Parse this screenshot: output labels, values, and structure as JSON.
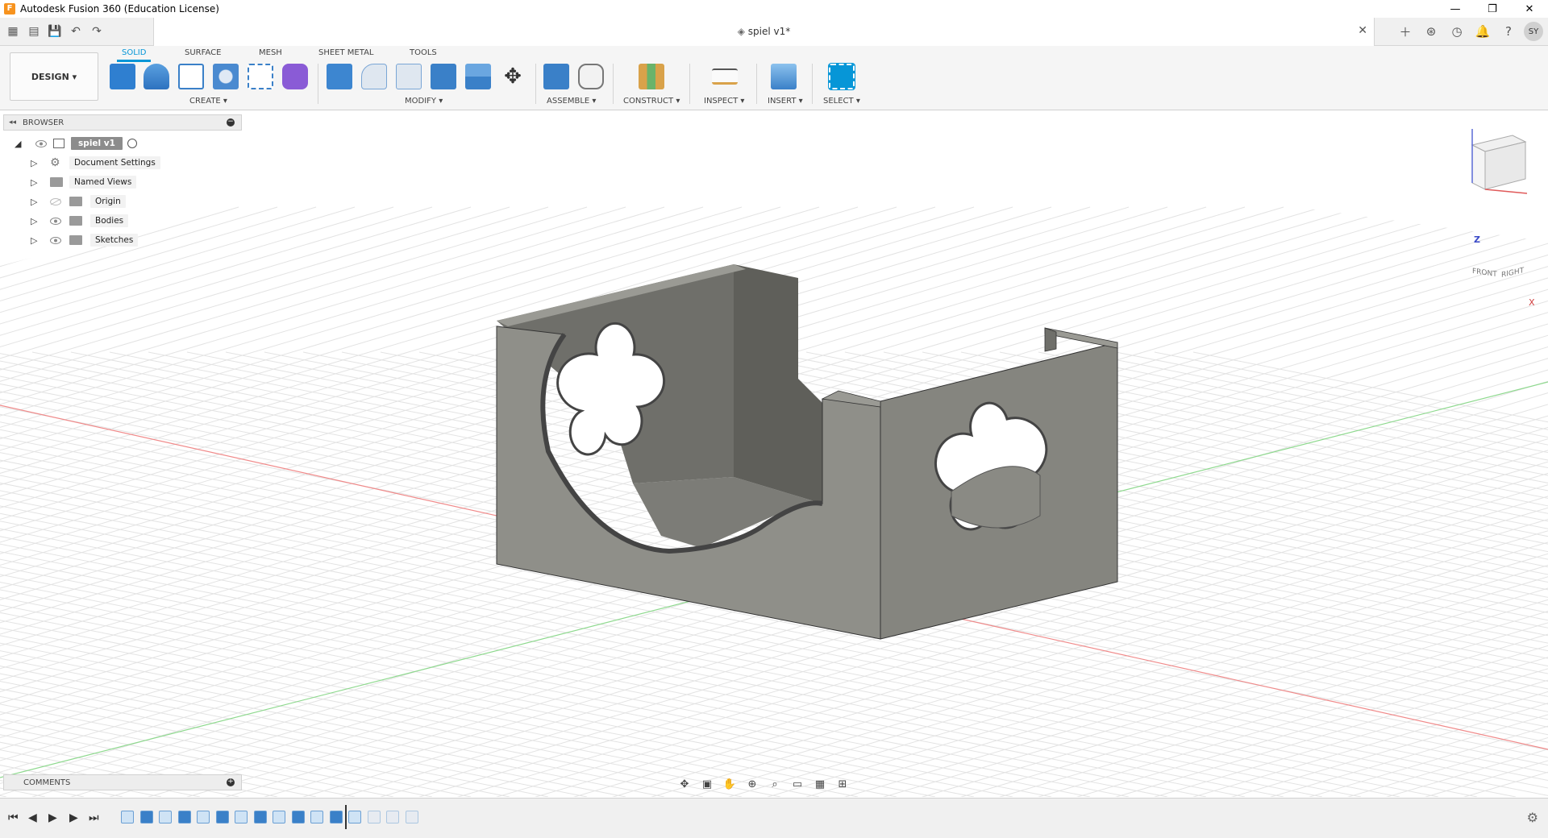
{
  "window": {
    "title": "Autodesk Fusion 360 (Education License)",
    "app_icon_letter": "F",
    "minimize": "—",
    "maximize": "❐",
    "close": "✕"
  },
  "tabbar": {
    "document_title": "spiel v1*",
    "close_glyph": "✕",
    "avatar_initials": "SY"
  },
  "toolbar": {
    "workspace": "DESIGN ▾",
    "tabs": [
      "SOLID",
      "SURFACE",
      "MESH",
      "SHEET METAL",
      "TOOLS"
    ],
    "groups": [
      "CREATE ▾",
      "MODIFY ▾",
      "ASSEMBLE ▾",
      "CONSTRUCT ▾",
      "INSPECT ▾",
      "INSERT ▾",
      "SELECT ▾"
    ]
  },
  "browser": {
    "header": "BROWSER",
    "root": "spiel v1",
    "items": [
      "Document Settings",
      "Named Views",
      "Origin",
      "Bodies",
      "Sketches"
    ]
  },
  "viewcube": {
    "front": "FRONT",
    "right": "RIGHT",
    "z": "Z",
    "x": "X"
  },
  "comments": {
    "label": "COMMENTS"
  },
  "colors": {
    "accent": "#0696d7",
    "body_front": "#8f8f89",
    "body_side": "#85857f",
    "body_inner": "#6f6f6a",
    "grid": "#e3e3e3",
    "axis_red": "#f08a8a",
    "axis_green": "#8fd98f"
  }
}
